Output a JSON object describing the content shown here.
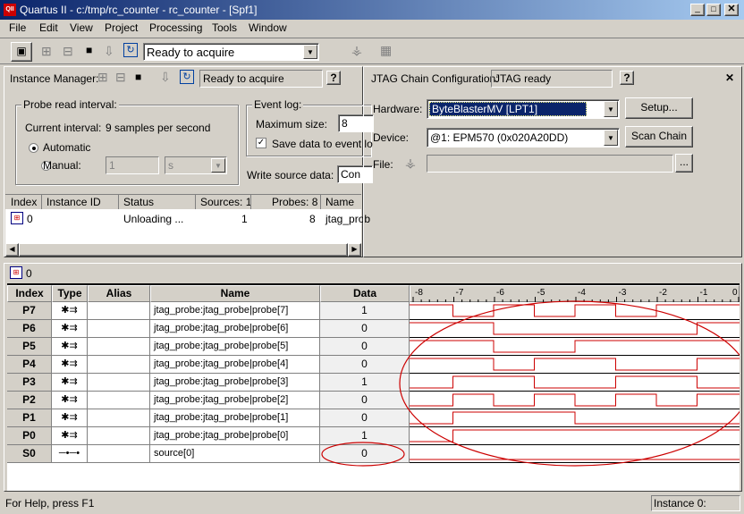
{
  "window": {
    "title": "Quartus II - c:/tmp/rc_counter - rc_counter - [Spf1]",
    "app_icon": "quartus-logo-icon"
  },
  "menu": [
    "File",
    "Edit",
    "View",
    "Project",
    "Processing",
    "Tools",
    "Window"
  ],
  "toolbar": {
    "status_combo": "Ready to acquire"
  },
  "instance_manager": {
    "label": "Instance Manager:",
    "status": "Ready to acquire",
    "probe_interval": {
      "legend": "Probe read interval:",
      "current_label": "Current interval:",
      "current_value": "9 samples per second",
      "automatic_label": "Automatic",
      "manual_label": "Manual:",
      "manual_value": "1",
      "manual_unit": "s"
    },
    "event_log": {
      "legend": "Event log:",
      "max_size_label": "Maximum size:",
      "max_size_value": "8",
      "save_label": "Save data to event lo"
    },
    "write_source_label": "Write source data:",
    "write_source_value": "Con",
    "table": {
      "headers": [
        "Index",
        "Instance ID",
        "Status",
        "Sources: 1",
        "Probes: 8",
        "Name"
      ],
      "rows": [
        {
          "index": "0",
          "instance_id": "",
          "status": "Unloading ...",
          "sources": "1",
          "probes": "8",
          "name": "jtag_prob"
        }
      ]
    }
  },
  "jtag": {
    "label": "JTAG Chain Configuration:",
    "status": "JTAG ready",
    "hardware_label": "Hardware:",
    "hardware_value": "ByteBlasterMV [LPT1]",
    "setup_button": "Setup...",
    "device_label": "Device:",
    "device_value": "@1: EPM570 (0x020A20DD)",
    "scan_button": "Scan Chain",
    "file_label": "File:",
    "browse_button": "..."
  },
  "waveform": {
    "instance_tab": "0",
    "headers": [
      "Index",
      "Type",
      "Alias",
      "Name",
      "Data"
    ],
    "time_ticks": [
      "-8",
      "-7",
      "-6",
      "-5",
      "-4",
      "-3",
      "-2",
      "-1",
      "0"
    ],
    "rows": [
      {
        "index": "P7",
        "type": "probe",
        "alias": "",
        "name": "jtag_probe:jtag_probe|probe[7]",
        "data": "1",
        "wave": [
          1,
          0,
          1,
          0,
          1,
          0,
          1,
          1
        ]
      },
      {
        "index": "P6",
        "type": "probe",
        "alias": "",
        "name": "jtag_probe:jtag_probe|probe[6]",
        "data": "0",
        "wave": [
          1,
          1,
          0,
          0,
          0,
          0,
          0,
          1
        ]
      },
      {
        "index": "P5",
        "type": "probe",
        "alias": "",
        "name": "jtag_probe:jtag_probe|probe[5]",
        "data": "0",
        "wave": [
          1,
          1,
          0,
          0,
          1,
          1,
          1,
          1
        ]
      },
      {
        "index": "P4",
        "type": "probe",
        "alias": "",
        "name": "jtag_probe:jtag_probe|probe[4]",
        "data": "0",
        "wave": [
          1,
          1,
          0,
          1,
          1,
          0,
          0,
          1
        ]
      },
      {
        "index": "P3",
        "type": "probe",
        "alias": "",
        "name": "jtag_probe:jtag_probe|probe[3]",
        "data": "1",
        "wave": [
          0,
          1,
          1,
          0,
          0,
          1,
          1,
          0
        ]
      },
      {
        "index": "P2",
        "type": "probe",
        "alias": "",
        "name": "jtag_probe:jtag_probe|probe[2]",
        "data": "0",
        "wave": [
          0,
          1,
          0,
          1,
          0,
          1,
          0,
          1
        ]
      },
      {
        "index": "P1",
        "type": "probe",
        "alias": "",
        "name": "jtag_probe:jtag_probe|probe[1]",
        "data": "0",
        "wave": [
          0,
          1,
          1,
          1,
          0,
          0,
          0,
          0
        ]
      },
      {
        "index": "P0",
        "type": "probe",
        "alias": "",
        "name": "jtag_probe:jtag_probe|probe[0]",
        "data": "1",
        "wave": [
          0,
          1,
          1,
          1,
          1,
          1,
          1,
          1
        ]
      },
      {
        "index": "S0",
        "type": "source",
        "alias": "",
        "name": "source[0]",
        "data": "0",
        "wave": [
          0,
          0,
          0,
          0,
          0,
          0,
          0,
          0
        ]
      }
    ],
    "wave_color": "#cc0000"
  },
  "statusbar": {
    "help": "For Help, press F1",
    "instance": "Instance 0:"
  }
}
